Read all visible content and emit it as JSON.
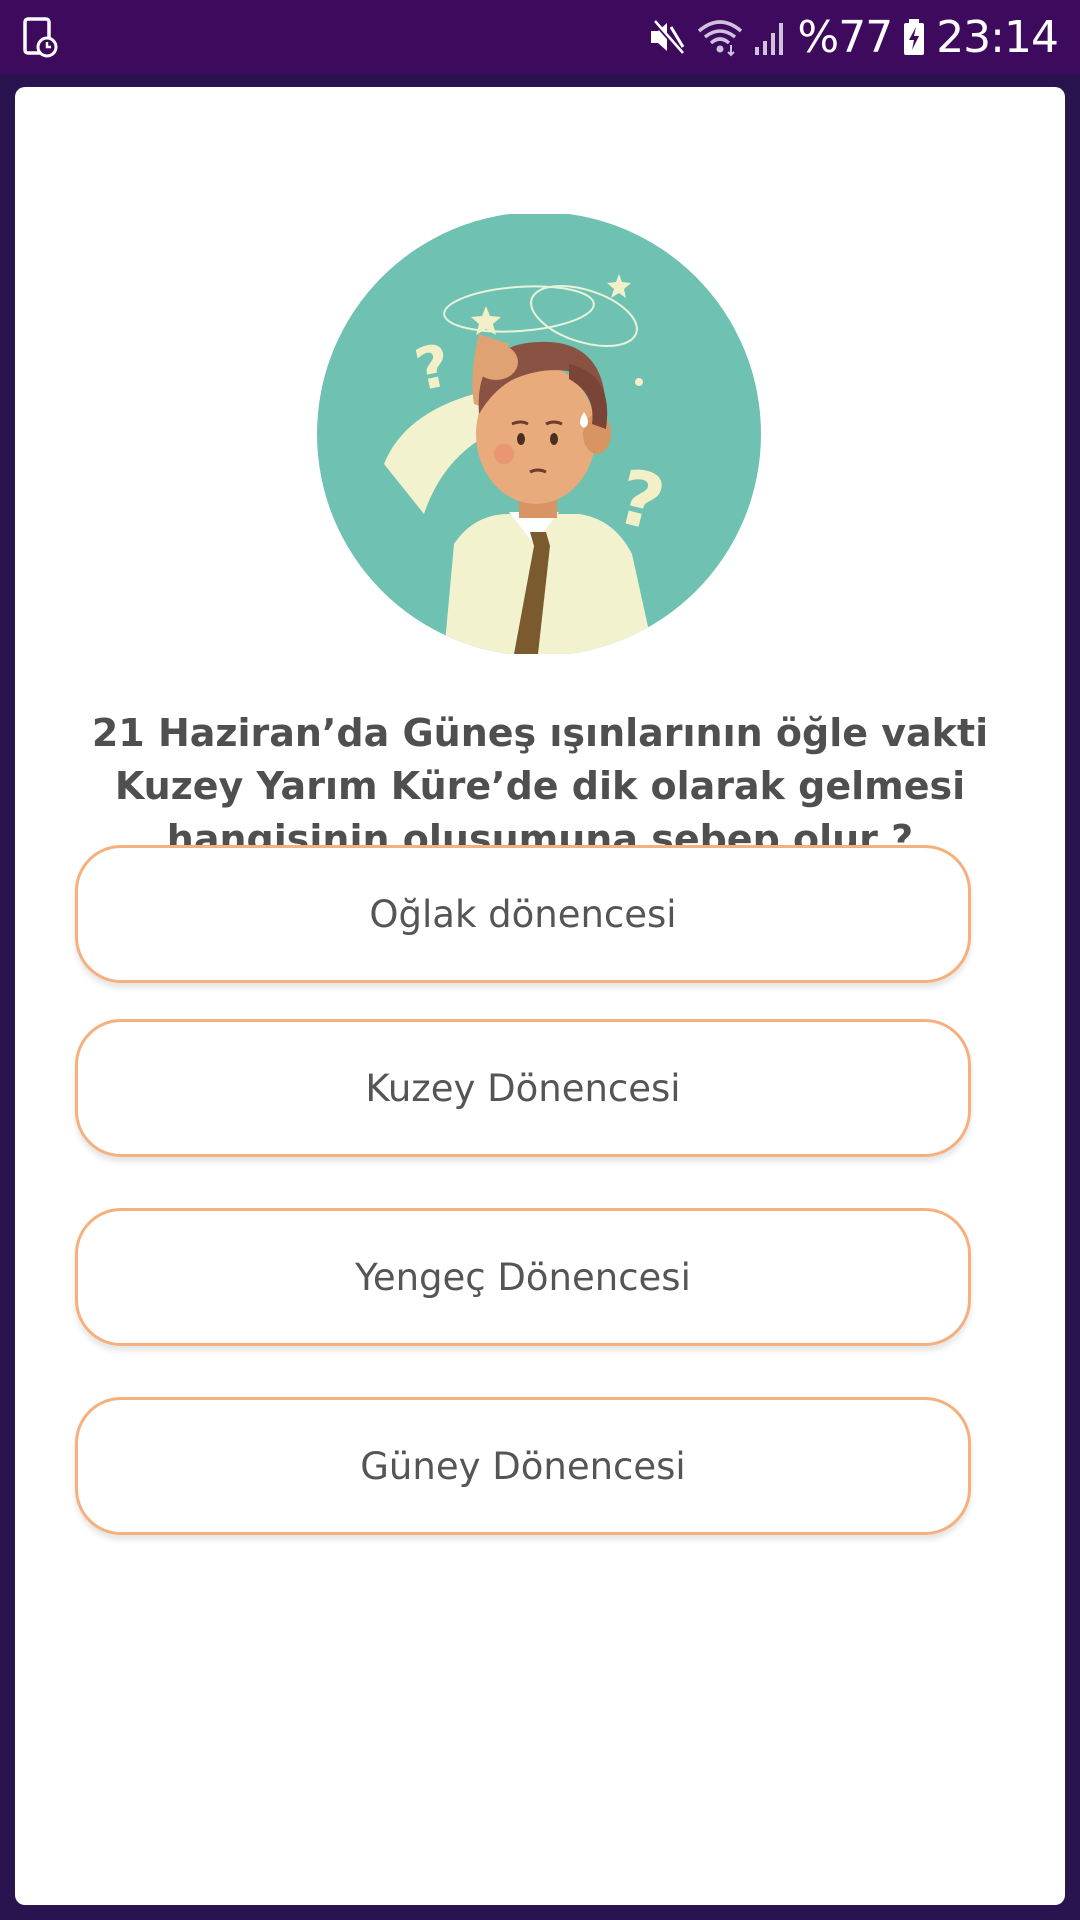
{
  "status_bar": {
    "battery_percent": "%77",
    "time": "23:14",
    "icons": [
      "screenshot-icon",
      "mute-icon",
      "wifi-icon",
      "signal-icon",
      "battery-charging-icon"
    ]
  },
  "quiz": {
    "illustration_icon": "confused-man-illustration",
    "question": "21 Haziran’da Güneş ışınlarının öğle vakti Kuzey Yarım Küre’de dik olarak gelmesi hangisinin oluşumuna sebep olur ?",
    "answers": [
      {
        "label": "Oğlak dönencesi"
      },
      {
        "label": "Kuzey Dönencesi"
      },
      {
        "label": "Yengeç Dönencesi"
      },
      {
        "label": "Güney Dönencesi"
      }
    ]
  },
  "colors": {
    "status_bar": "#3d0a5e",
    "background": "#2a1450",
    "answer_border": "#f6b07e",
    "illustration_circle": "#6fc1b1",
    "text": "#4f4f4f"
  }
}
